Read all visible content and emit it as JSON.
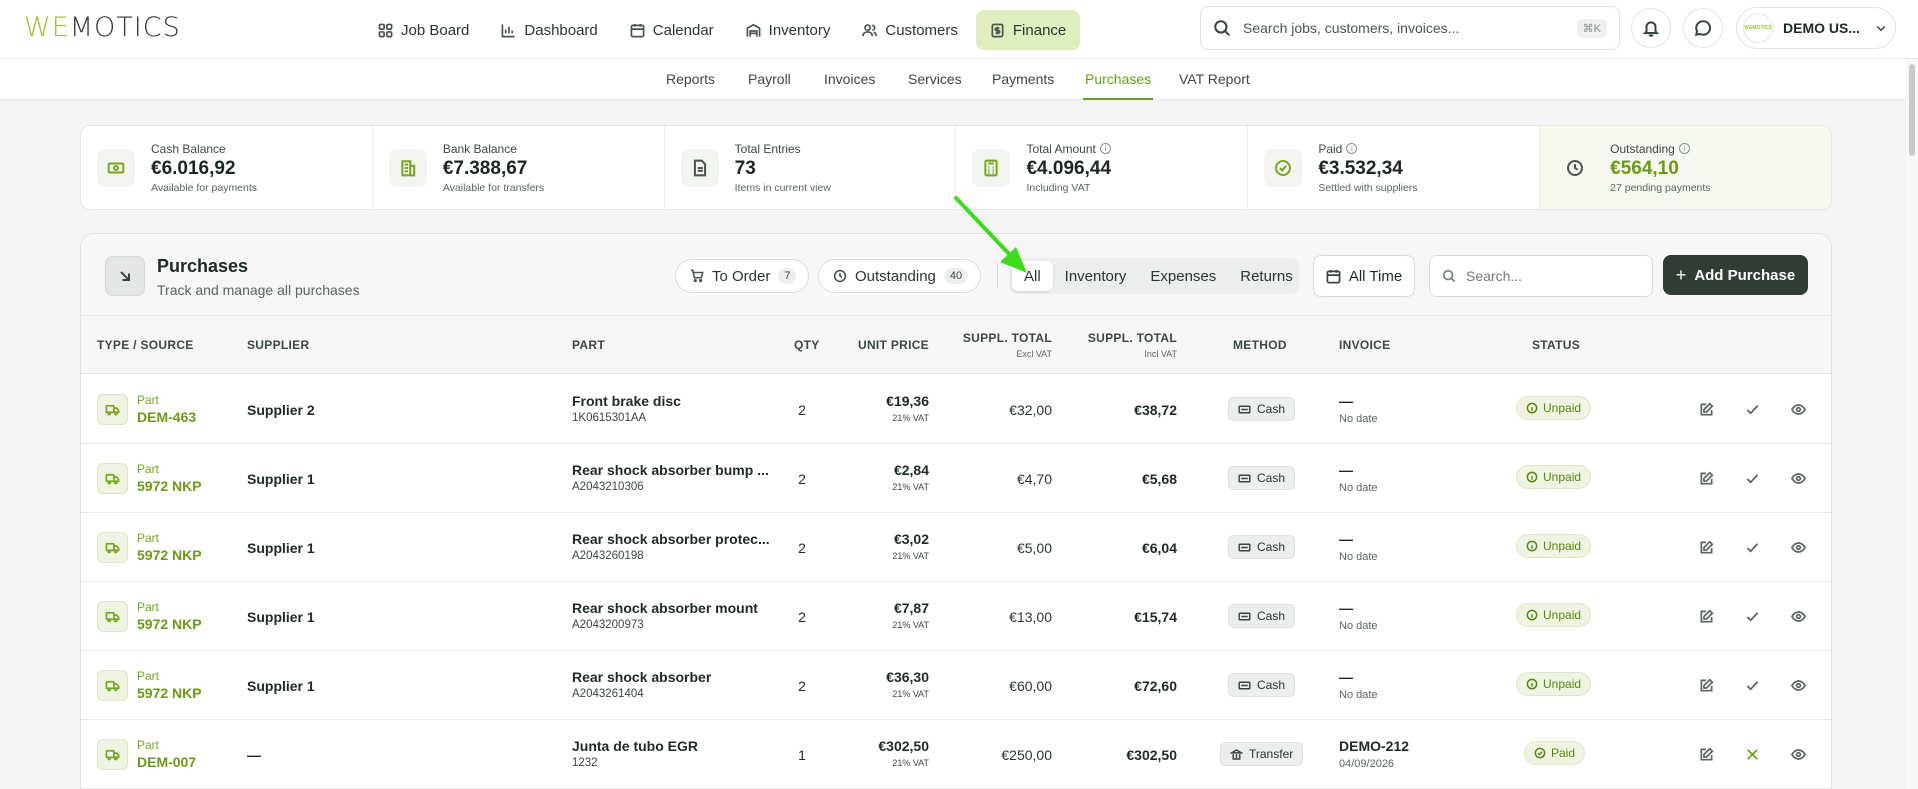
{
  "brand": {
    "logo_we": "WE",
    "logo_rest": "MOTICS"
  },
  "nav": [
    {
      "label": "Job Board",
      "icon": "grid-icon"
    },
    {
      "label": "Dashboard",
      "icon": "bar-chart-icon"
    },
    {
      "label": "Calendar",
      "icon": "calendar-icon"
    },
    {
      "label": "Inventory",
      "icon": "warehouse-icon"
    },
    {
      "label": "Customers",
      "icon": "users-icon"
    },
    {
      "label": "Finance",
      "icon": "receipt-icon",
      "active": true
    }
  ],
  "search": {
    "placeholder": "Search jobs, customers, invoices...",
    "shortcut": "⌘K"
  },
  "user": {
    "name": "DEMO US...",
    "avatar_text": "WEMOTICS"
  },
  "subnav": [
    "Reports",
    "Payroll",
    "Invoices",
    "Services",
    "Payments",
    "Purchases",
    "VAT Report"
  ],
  "subnav_active": "Purchases",
  "stats": [
    {
      "label": "Cash Balance",
      "value": "€6.016,92",
      "sub": "Available for payments",
      "icon": "cash-icon",
      "info": false
    },
    {
      "label": "Bank Balance",
      "value": "€7.388,67",
      "sub": "Available for transfers",
      "icon": "bank-icon",
      "info": false
    },
    {
      "label": "Total Entries",
      "value": "73",
      "sub": "Items in current view",
      "icon": "document-icon",
      "info": false
    },
    {
      "label": "Total Amount",
      "value": "€4.096,44",
      "sub": "Including VAT",
      "icon": "calculator-icon",
      "info": true
    },
    {
      "label": "Paid",
      "value": "€3.532,34",
      "sub": "Settled with suppliers",
      "icon": "check-circle-icon",
      "info": true
    },
    {
      "label": "Outstanding",
      "value": "€564,10",
      "sub": "27 pending payments",
      "icon": "clock-icon",
      "info": true
    }
  ],
  "panel": {
    "title": "Purchases",
    "subtitle": "Track and manage all purchases",
    "chips": [
      {
        "label": "To Order",
        "count": "7"
      },
      {
        "label": "Outstanding",
        "count": "40"
      }
    ],
    "segments": [
      "All",
      "Inventory",
      "Expenses",
      "Returns"
    ],
    "segment_active": "All",
    "time_filter": "All Time",
    "search_placeholder": "Search...",
    "add_label": "Add Purchase"
  },
  "table": {
    "headers": {
      "type": "TYPE / SOURCE",
      "supplier": "SUPPLIER",
      "part": "PART",
      "qty": "QTY",
      "unit_price": "UNIT PRICE",
      "suppl_total_excl": "SUPPL. TOTAL",
      "suppl_total_excl_sub": "Excl VAT",
      "suppl_total_incl": "SUPPL. TOTAL",
      "suppl_total_incl_sub": "Incl VAT",
      "method": "METHOD",
      "invoice": "INVOICE",
      "status": "STATUS"
    },
    "rows": [
      {
        "kind": "Part",
        "ref": "DEM-463",
        "supplier": "Supplier 2",
        "part": "Front brake disc",
        "code": "1K0615301AA",
        "qty": "2",
        "unit": "€19,36",
        "vat": "21% VAT",
        "excl": "€32,00",
        "incl": "€38,72",
        "method": "Cash",
        "invoice": "—",
        "inv_date": "No date",
        "status": "Unpaid"
      },
      {
        "kind": "Part",
        "ref": "5972 NKP",
        "supplier": "Supplier 1",
        "part": "Rear shock absorber bump ...",
        "code": "A2043210306",
        "qty": "2",
        "unit": "€2,84",
        "vat": "21% VAT",
        "excl": "€4,70",
        "incl": "€5,68",
        "method": "Cash",
        "invoice": "—",
        "inv_date": "No date",
        "status": "Unpaid"
      },
      {
        "kind": "Part",
        "ref": "5972 NKP",
        "supplier": "Supplier 1",
        "part": "Rear shock absorber protec...",
        "code": "A2043260198",
        "qty": "2",
        "unit": "€3,02",
        "vat": "21% VAT",
        "excl": "€5,00",
        "incl": "€6,04",
        "method": "Cash",
        "invoice": "—",
        "inv_date": "No date",
        "status": "Unpaid"
      },
      {
        "kind": "Part",
        "ref": "5972 NKP",
        "supplier": "Supplier 1",
        "part": "Rear shock absorber mount",
        "code": "A2043200973",
        "qty": "2",
        "unit": "€7,87",
        "vat": "21% VAT",
        "excl": "€13,00",
        "incl": "€15,74",
        "method": "Cash",
        "invoice": "—",
        "inv_date": "No date",
        "status": "Unpaid"
      },
      {
        "kind": "Part",
        "ref": "5972 NKP",
        "supplier": "Supplier 1",
        "part": "Rear shock absorber",
        "code": "A2043261404",
        "qty": "2",
        "unit": "€36,30",
        "vat": "21% VAT",
        "excl": "€60,00",
        "incl": "€72,60",
        "method": "Cash",
        "invoice": "—",
        "inv_date": "No date",
        "status": "Unpaid"
      },
      {
        "kind": "Part",
        "ref": "DEM-007",
        "supplier": "—",
        "part": "Junta de tubo EGR",
        "code": "1232",
        "qty": "1",
        "unit": "€302,50",
        "vat": "21% VAT",
        "excl": "€250,00",
        "incl": "€302,50",
        "method": "Transfer",
        "invoice": "DEMO-212",
        "inv_date": "04/09/2026",
        "status": "Paid"
      }
    ]
  },
  "colors": {
    "accent": "#6b9b16",
    "nav_active_bg": "#dfeebf",
    "button_dark": "#2f3d35",
    "annotation_arrow": "#3ddc1a"
  }
}
